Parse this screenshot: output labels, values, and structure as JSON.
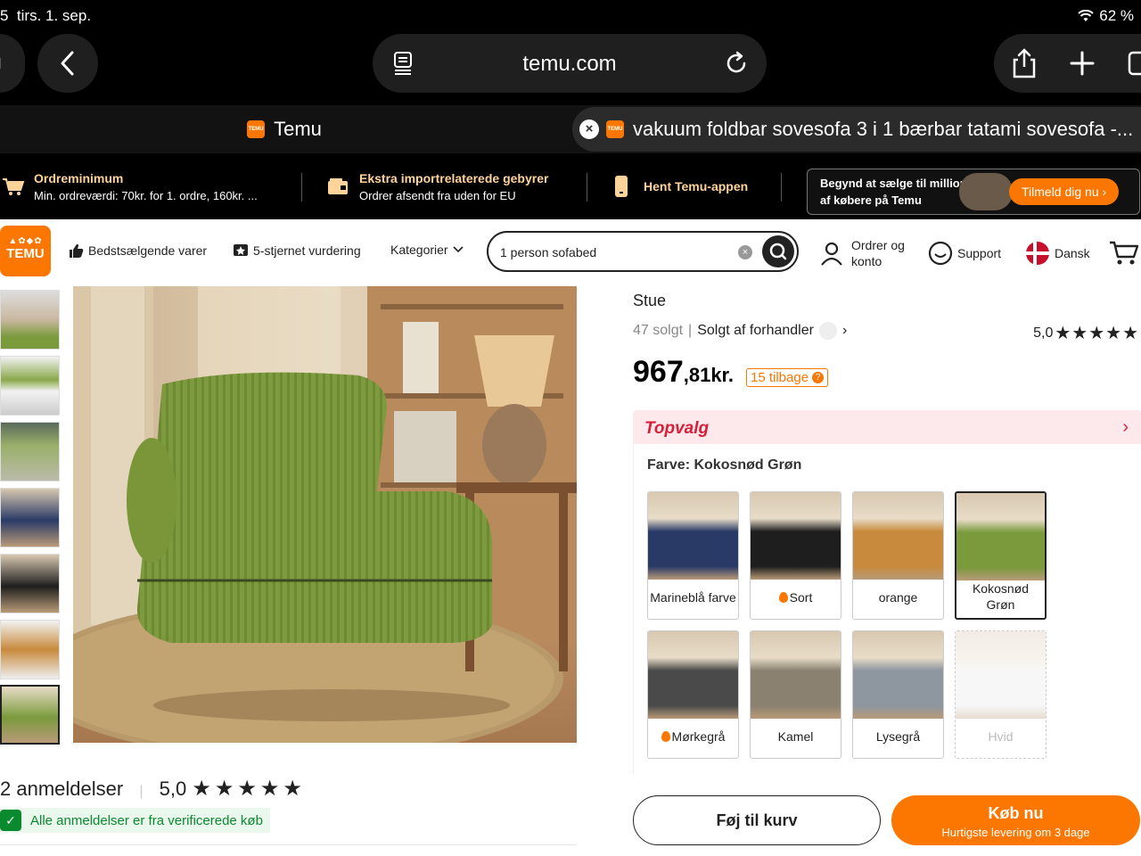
{
  "status": {
    "time": "5",
    "date": "tirs. 1. sep.",
    "battery": "62 %"
  },
  "browser": {
    "url": "temu.com"
  },
  "tabs": [
    {
      "title": "Temu"
    },
    {
      "title": "vakuum foldbar sovesofa 3 i 1 bærbar tatami sovesofa -..."
    }
  ],
  "promo": {
    "item1": {
      "title": "Ordreminimum",
      "sub": "Min. ordreværdi: 70kr. for 1. ordre, 160kr. ..."
    },
    "item2": {
      "title": "Ekstra importrelaterede gebyrer",
      "sub": "Ordrer afsendt fra uden for EU"
    },
    "item3": {
      "title": "Hent Temu-appen"
    },
    "join": {
      "text1": "Begynd at sælge til millioner",
      "text2": "af købere på Temu",
      "button": "Tilmeld dig nu"
    }
  },
  "header": {
    "logo": "TEMU",
    "nav": [
      "Bedstsælgende varer",
      "5-stjernet vurdering",
      "Kategorier"
    ],
    "search_value": "1 person sofabed",
    "account": [
      "Ordrer og",
      "konto"
    ],
    "support": "Support",
    "language": "Dansk"
  },
  "product": {
    "category": "Stue",
    "sold": "47 solgt",
    "separator": "|",
    "seller": "Solgt af forhandler",
    "rating": "5,0",
    "price_int": "967",
    "price_dec": ",81kr.",
    "coupon": "15 tilbage",
    "topvalg": "Topvalg",
    "color_label": "Farve: Kokosnød Grøn"
  },
  "swatches": [
    {
      "name": "Marineblå farve",
      "color": "#2a3a66",
      "hot": false,
      "selected": false,
      "disabled": false
    },
    {
      "name": "Sort",
      "color": "#1e1e1e",
      "hot": true,
      "selected": false,
      "disabled": false
    },
    {
      "name": "orange",
      "color": "#c88a3c",
      "hot": false,
      "selected": false,
      "disabled": false
    },
    {
      "name": "Kokosnød Grøn",
      "color": "#7a9a3c",
      "hot": false,
      "selected": true,
      "disabled": false
    },
    {
      "name": "Mørkegrå",
      "color": "#4a4a4a",
      "hot": true,
      "selected": false,
      "disabled": false
    },
    {
      "name": "Kamel",
      "color": "#8a8170",
      "hot": false,
      "selected": false,
      "disabled": false
    },
    {
      "name": "Lysegrå",
      "color": "#8e96a0",
      "hot": false,
      "selected": false,
      "disabled": false
    },
    {
      "name": "Hvid",
      "color": "#e8e8e8",
      "hot": false,
      "selected": false,
      "disabled": true
    }
  ],
  "reviews": {
    "count": "2 anmeldelser",
    "rating": "5,0",
    "verified": "Alle anmeldelser er fra verificerede køb"
  },
  "actions": {
    "add_to_cart": "Føj til kurv",
    "buy_now": "Køb nu",
    "delivery": "Hurtigste levering om 3 dage"
  },
  "colors": {
    "accent": "#fb7701",
    "topvalg": "#d6203a",
    "verified": "#0a8a2e"
  }
}
